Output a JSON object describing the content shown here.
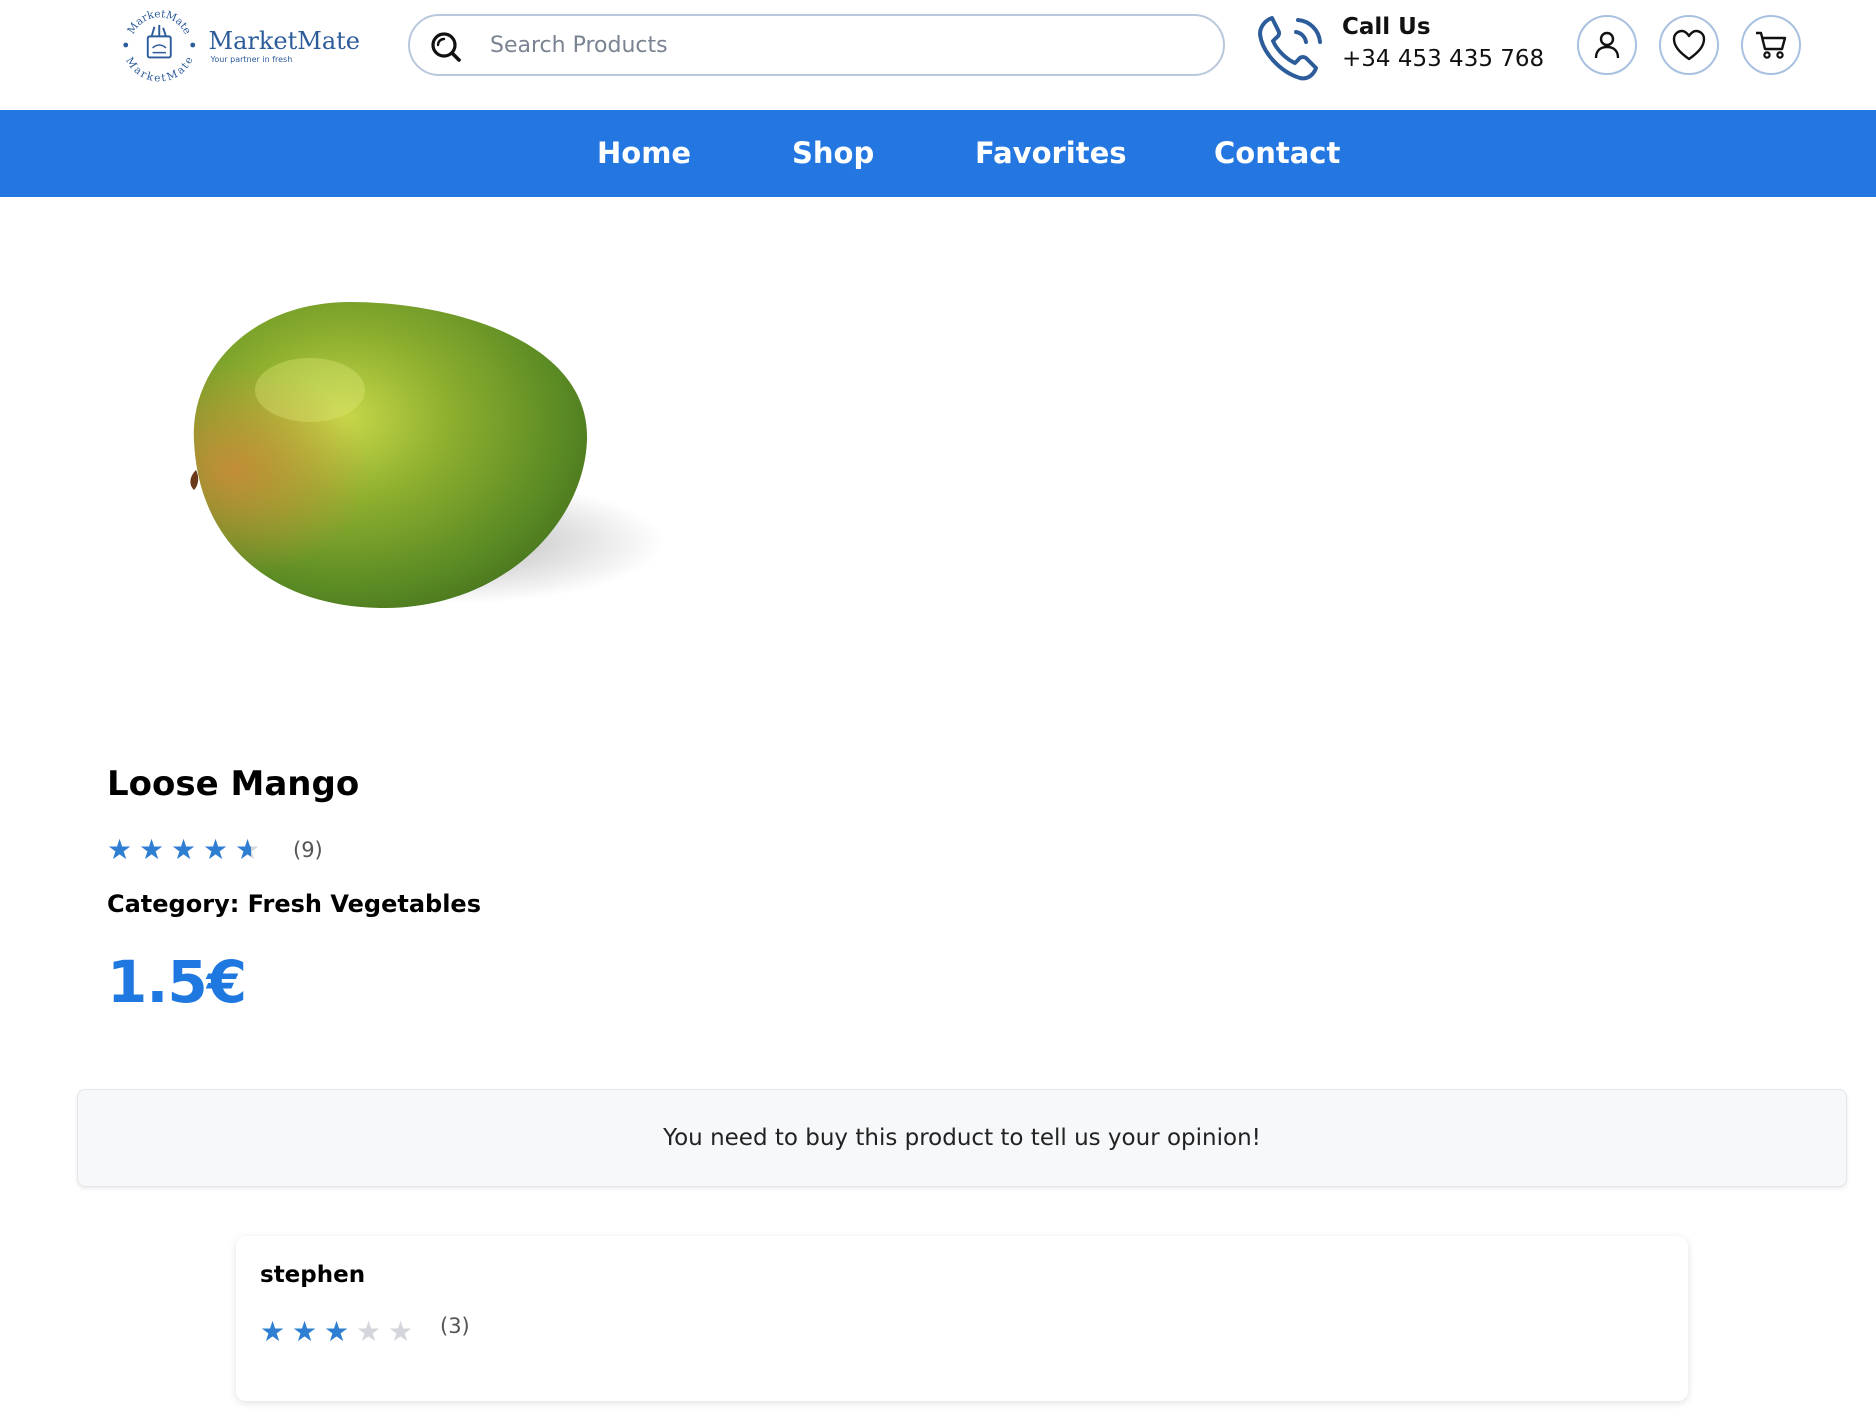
{
  "header": {
    "logo": {
      "name": "MarketMate",
      "tagline": "Your partner in fresh",
      "ring_text": "MarketMate"
    },
    "search": {
      "placeholder": "Search Products",
      "value": ""
    },
    "contact": {
      "label": "Call Us",
      "phone": "+34 453 435 768"
    },
    "icons": [
      "user-icon",
      "heart-icon",
      "cart-icon"
    ]
  },
  "nav": {
    "items": [
      {
        "label": "Home"
      },
      {
        "label": "Shop"
      },
      {
        "label": "Favorites"
      },
      {
        "label": "Contact"
      }
    ],
    "color": "#2477e0"
  },
  "product": {
    "name": "Loose Mango",
    "rating": 4.5,
    "rating_count": "(9)",
    "category": "Category: Fresh Vegetables",
    "price": "1.5€"
  },
  "notice": {
    "text": "You need to buy this product to tell us your opinion!"
  },
  "reviews": [
    {
      "author": "stephen",
      "rating": 3,
      "rating_count": "(3)"
    }
  ],
  "colors": {
    "accent": "#1f78e0",
    "star": "#2e7fd1",
    "star_off": "#d3d6da"
  }
}
